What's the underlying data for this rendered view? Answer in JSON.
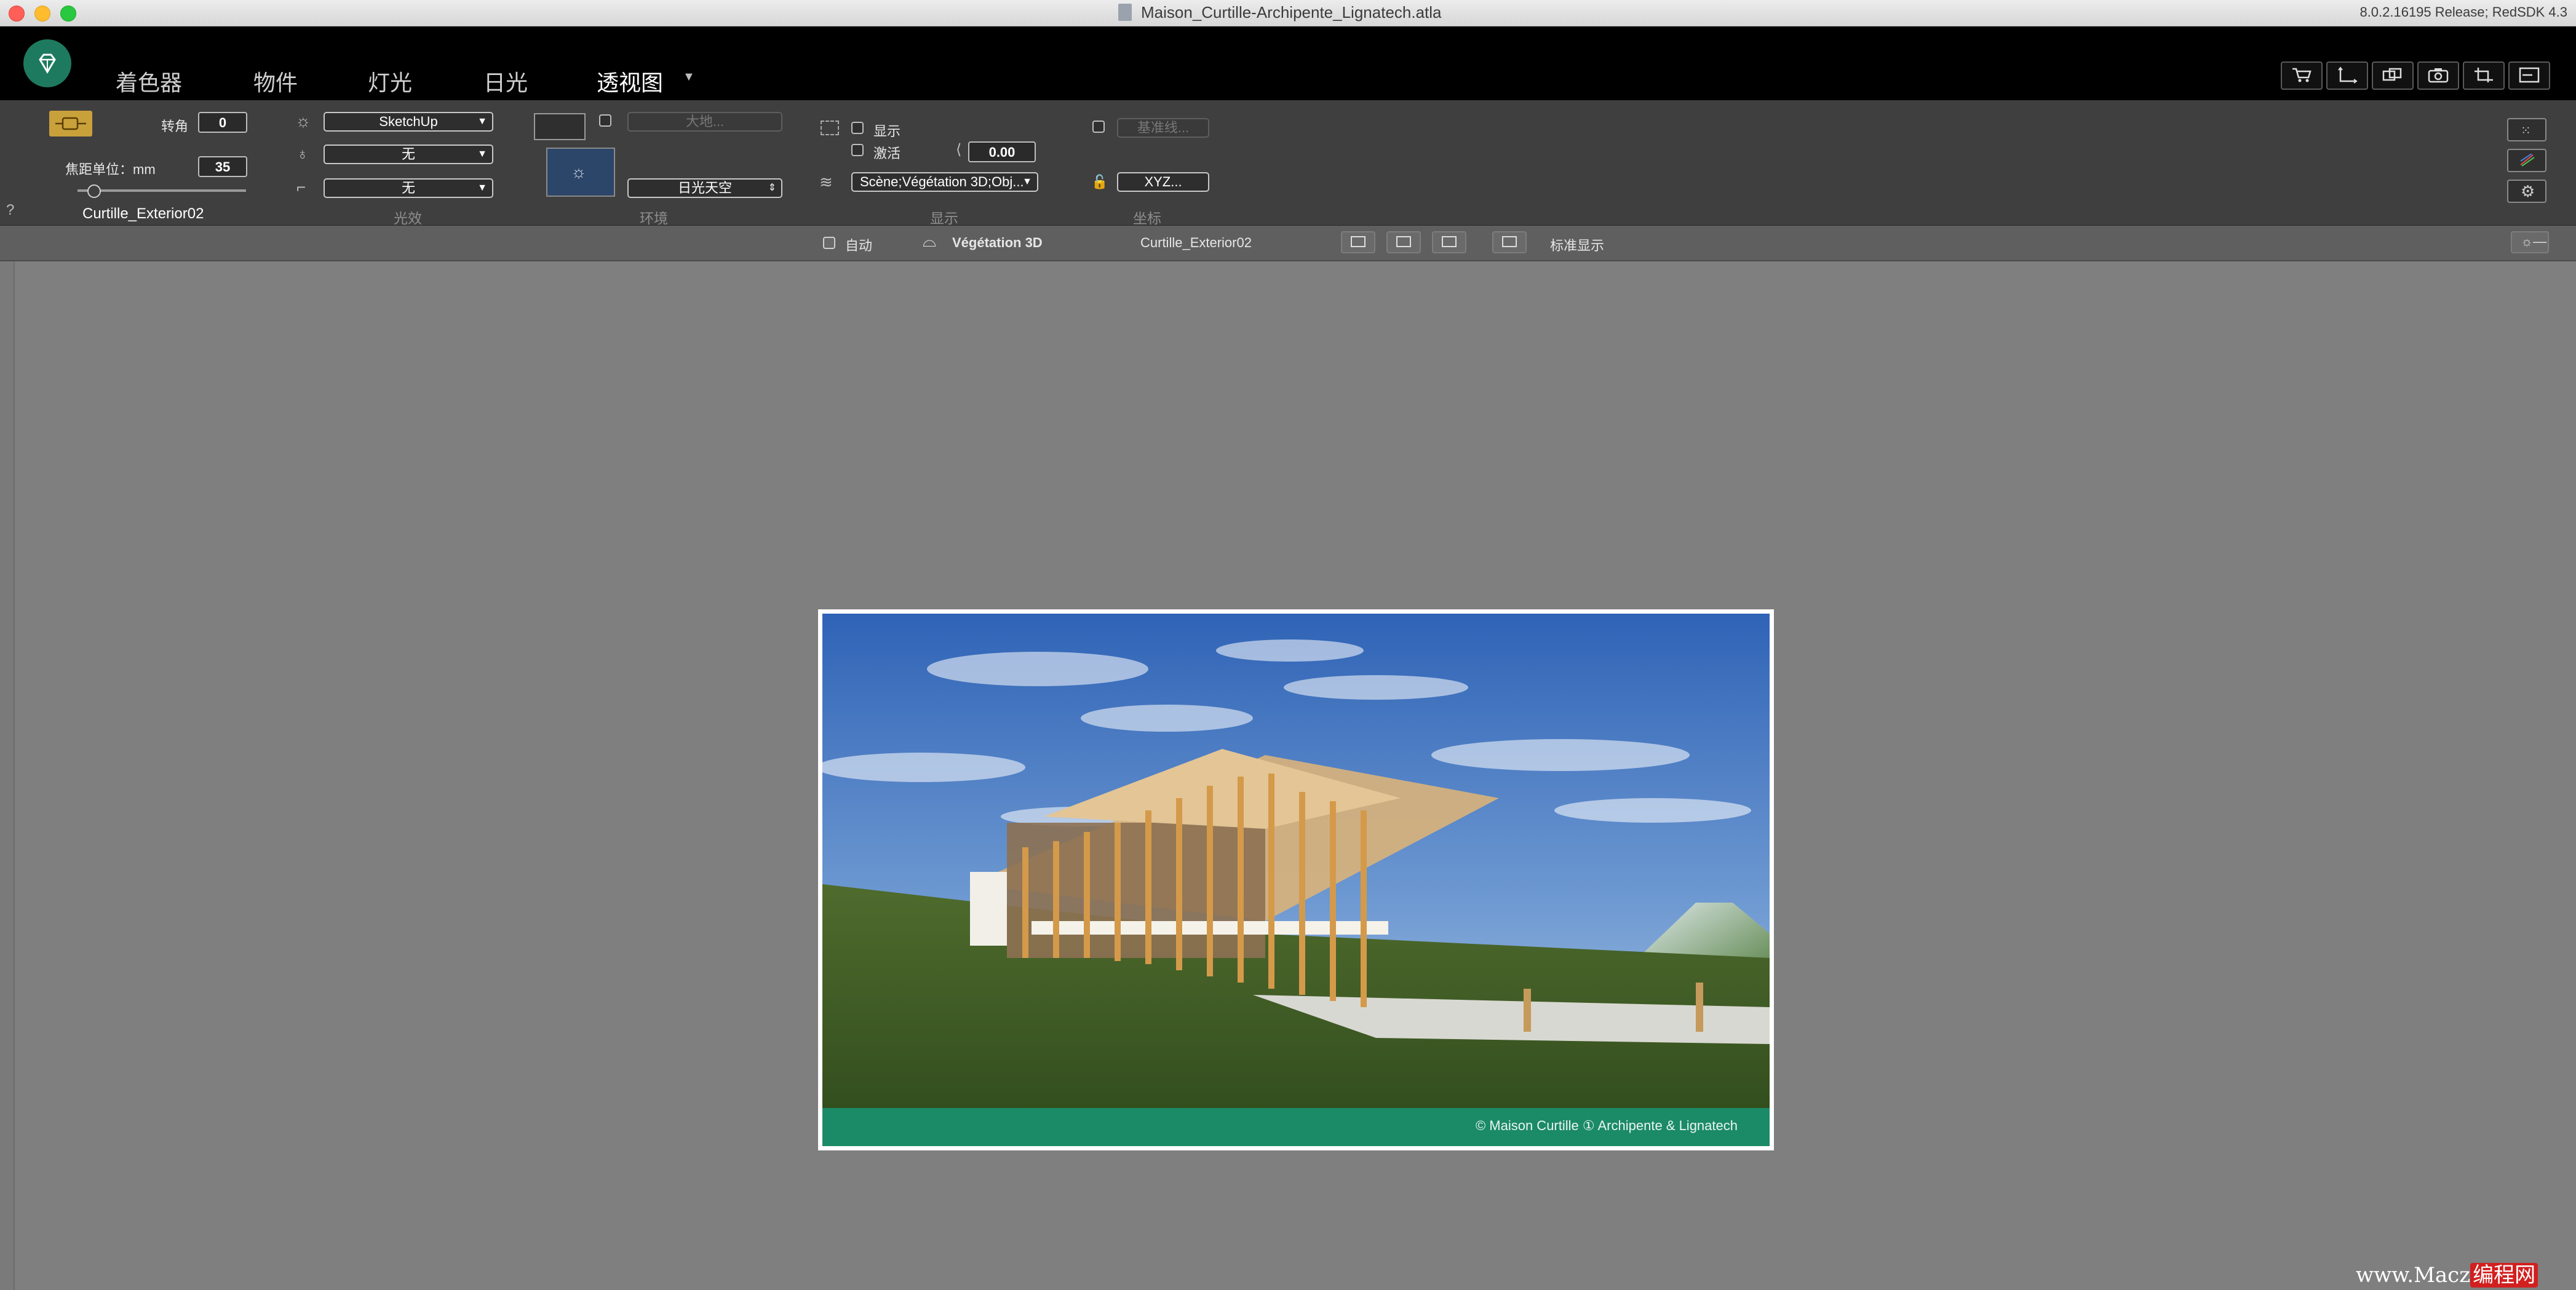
{
  "window": {
    "title": "Maison_Curtille-Archipente_Lignatech.atla",
    "version": "8.0.2.16195 Release; RedSDK 4.3"
  },
  "tabs": [
    {
      "label": "着色器"
    },
    {
      "label": "物件"
    },
    {
      "label": "灯光"
    },
    {
      "label": "日光"
    },
    {
      "label": "透视图",
      "active": true
    }
  ],
  "camera": {
    "rotation_label": "转角",
    "rotation_value": "0",
    "focal_label": "焦距单位：mm",
    "focal_value": "35",
    "view_name": "Curtille_Exterior02",
    "help": "?"
  },
  "lighting": {
    "preset": "SketchUp",
    "option2": "无",
    "option3": "无",
    "group_label": "光效"
  },
  "environment": {
    "ground_placeholder": "大地...",
    "sky": "日光天空",
    "group_label": "环境"
  },
  "display": {
    "show_label": "显示",
    "activate_label": "激活",
    "angle_value": "0.00",
    "layers": "Scène;Végétation 3D;Obj...",
    "group_label": "显示"
  },
  "coords": {
    "baseline_placeholder": "基准线...",
    "xyz_button": "XYZ...",
    "group_label": "坐标"
  },
  "statusbar": {
    "auto_label": "自动",
    "layer_name": "Végétation 3D",
    "view_name": "Curtille_Exterior02",
    "display_mode": "标准显示"
  },
  "render": {
    "credit": "© Maison Curtille ① Archipente & Lignatech"
  },
  "watermark": {
    "prefix": "www.Mac",
    "suffix": "z",
    "tag": "编程网"
  }
}
